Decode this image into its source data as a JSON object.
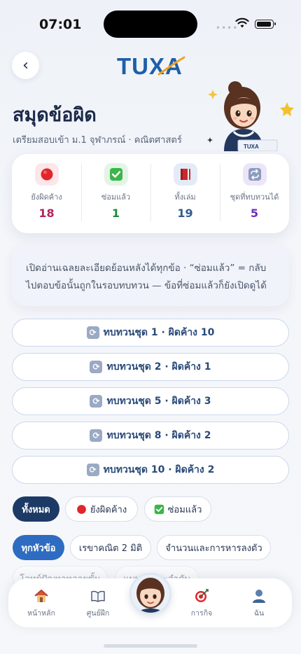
{
  "status": {
    "time": "07:01"
  },
  "header": {
    "logo_text": "TUXA",
    "back_icon": "chevron-left-icon"
  },
  "page": {
    "title": "สมุดข้อผิด",
    "subtitle": "เตรียมสอบเข้า ม.1 จุฬาภรณ์ · คณิตศาสตร์"
  },
  "mascot": {
    "book_label": "TUXA"
  },
  "stats": [
    {
      "icon": "red-circle-icon",
      "label": "ยังผิดค้าง",
      "value": "18",
      "color": "#b0245e",
      "bg": "#fde6ea"
    },
    {
      "icon": "check-box-icon",
      "label": "ซ่อมแล้ว",
      "value": "1",
      "color": "#1b8a3a",
      "bg": "#e2f5e6"
    },
    {
      "icon": "book-icon",
      "label": "ทั้งเล่ม",
      "value": "19",
      "color": "#2f5d8f",
      "bg": "#e3ebf7"
    },
    {
      "icon": "repeat-icon",
      "label": "ชุดที่ทบทวนได้",
      "value": "5",
      "color": "#6a2fb8",
      "bg": "#ece5f8"
    }
  ],
  "info": {
    "text": "เปิดอ่านเฉลยละเอียดย้อนหลังได้ทุกข้อ · “ซ่อมแล้ว” = กลับไปตอบข้อนั้นถูกในรอบทบทวน — ข้อที่ซ่อมแล้วก็ยังเปิดดูได้"
  },
  "review_sets": [
    {
      "label": "ทบทวนชุด 1 · ผิดค้าง 10"
    },
    {
      "label": "ทบทวนชุด 2 · ผิดค้าง 1"
    },
    {
      "label": "ทบทวนชุด 5 · ผิดค้าง 3"
    },
    {
      "label": "ทบทวนชุด 8 · ผิดค้าง 2"
    },
    {
      "label": "ทบทวนชุด 10 · ผิดค้าง 2"
    }
  ],
  "status_filters": [
    {
      "label": "ทั้งหมด",
      "active": true
    },
    {
      "label": "ยังผิดค้าง",
      "icon": "red-circle-icon"
    },
    {
      "label": "ซ่อมแล้ว",
      "icon": "check-box-icon"
    }
  ],
  "topic_filters": [
    {
      "label": "ทุกหัวข้อ",
      "active": true
    },
    {
      "label": "เรขาคณิต 2 มิติ"
    },
    {
      "label": "จำนวนและการหารลงตัว"
    },
    {
      "label": "โจทย์ปัญหาหลายขั้น"
    },
    {
      "label": "แบบรูปและลำดับ"
    }
  ],
  "nav": {
    "items": [
      {
        "label": "หน้าหลัก",
        "icon": "house-icon"
      },
      {
        "label": "ศูนย์ฝึก",
        "icon": "open-book-icon"
      },
      {
        "label": "การกิจ",
        "icon": "target-icon"
      },
      {
        "label": "ฉัน",
        "icon": "user-icon"
      }
    ]
  },
  "colors": {
    "accent": "#1f5fa8",
    "dark_chip": "#1d3a66",
    "blue_chip": "#2d6cc0"
  }
}
